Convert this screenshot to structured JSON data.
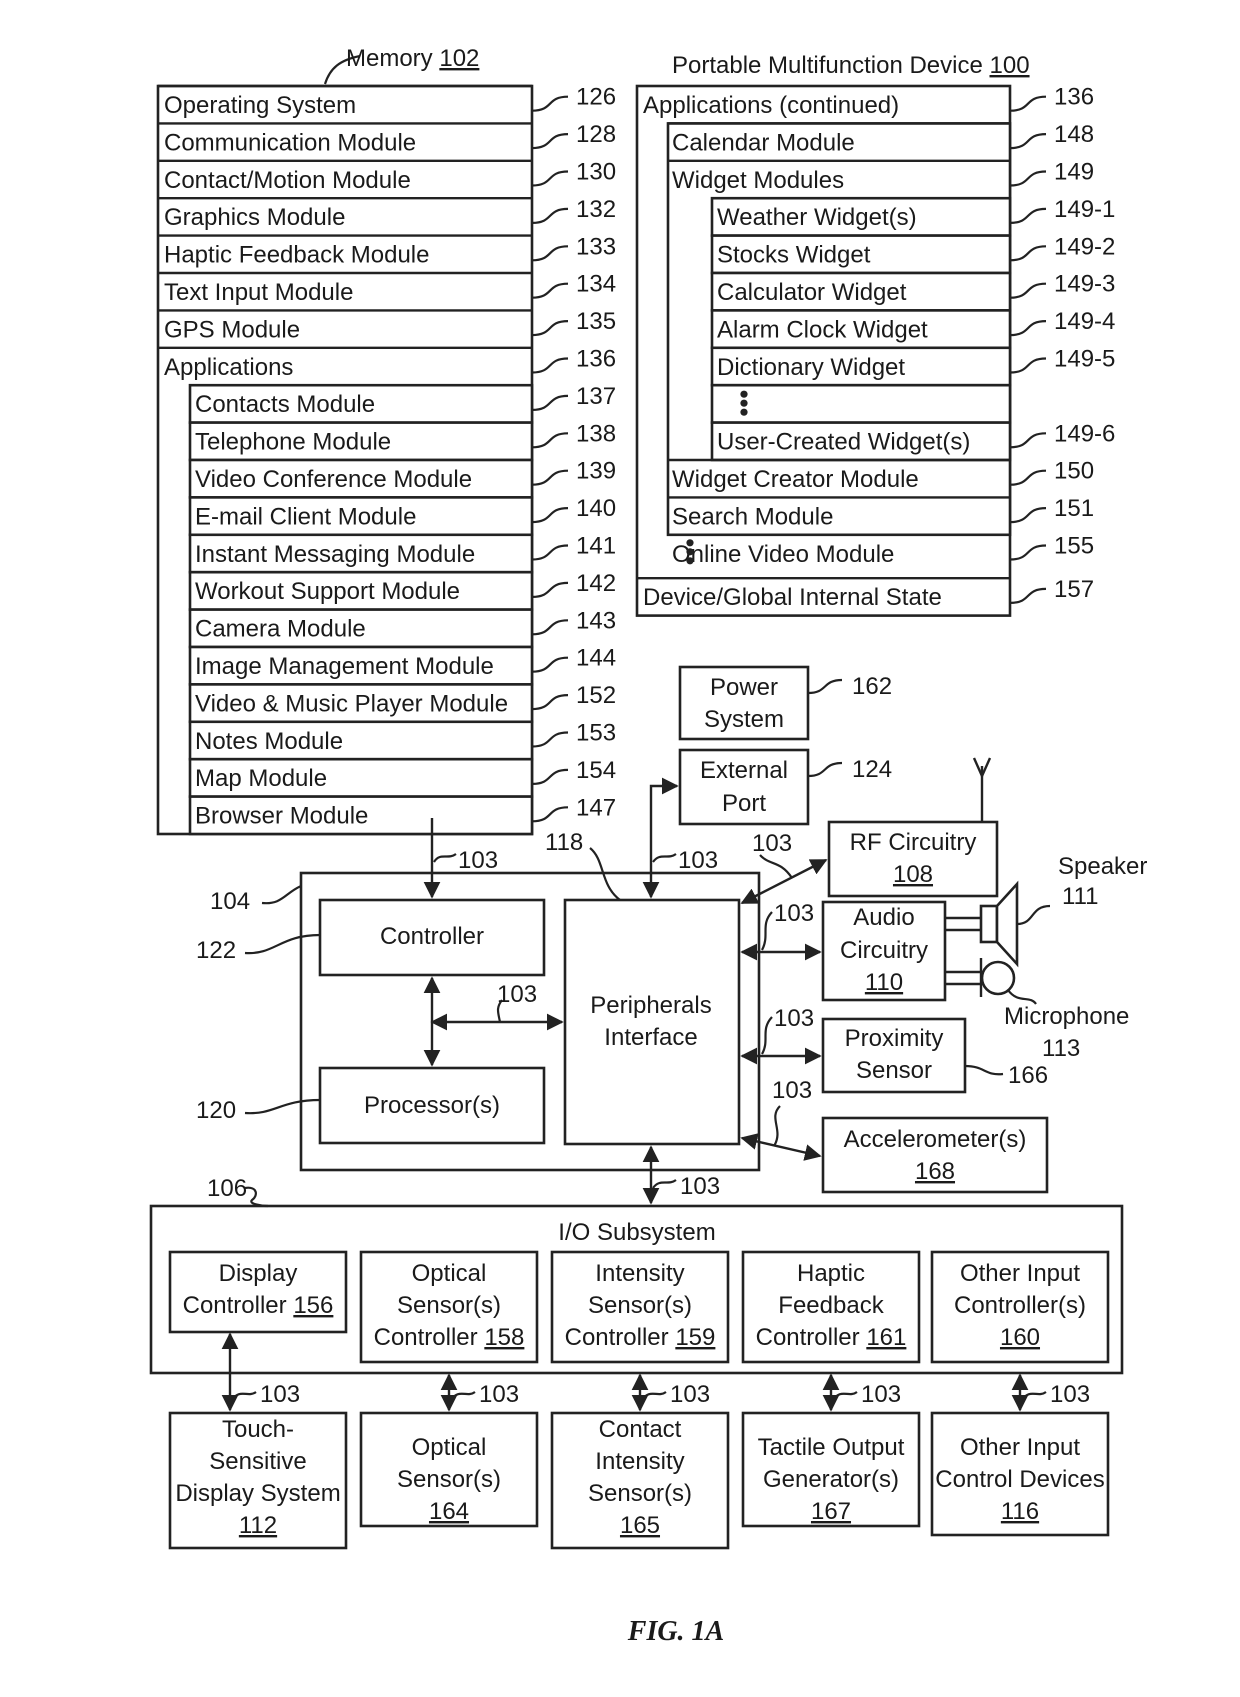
{
  "figure": {
    "caption": "FIG. 1A"
  },
  "memory": {
    "title": "Memory",
    "ref": "102",
    "rows": [
      {
        "label": "Operating System",
        "ref": "126"
      },
      {
        "label": "Communication Module",
        "ref": "128"
      },
      {
        "label": "Contact/Motion Module",
        "ref": "130"
      },
      {
        "label": "Graphics Module",
        "ref": "132"
      },
      {
        "label": "Haptic Feedback Module",
        "ref": "133"
      },
      {
        "label": "Text Input Module",
        "ref": "134"
      },
      {
        "label": "GPS Module",
        "ref": "135"
      },
      {
        "label": "Applications",
        "ref": "136"
      }
    ],
    "apps": [
      {
        "label": "Contacts Module",
        "ref": "137"
      },
      {
        "label": "Telephone Module",
        "ref": "138"
      },
      {
        "label": "Video Conference Module",
        "ref": "139"
      },
      {
        "label": "E-mail Client Module",
        "ref": "140"
      },
      {
        "label": "Instant Messaging Module",
        "ref": "141"
      },
      {
        "label": "Workout Support Module",
        "ref": "142"
      },
      {
        "label": "Camera Module",
        "ref": "143"
      },
      {
        "label": "Image Management Module",
        "ref": "144"
      },
      {
        "label": "Video & Music Player Module",
        "ref": "152"
      },
      {
        "label": "Notes Module",
        "ref": "153"
      },
      {
        "label": "Map Module",
        "ref": "154"
      },
      {
        "label": "Browser Module",
        "ref": "147"
      }
    ]
  },
  "device": {
    "title": "Portable Multifunction Device",
    "ref": "100",
    "apps_continued": {
      "label": "Applications (continued)",
      "ref": "136"
    },
    "calendar": {
      "label": "Calendar Module",
      "ref": "148"
    },
    "widget_modules": {
      "label": "Widget Modules",
      "ref": "149"
    },
    "widgets": [
      {
        "label": "Weather Widget(s)",
        "ref": "149-1"
      },
      {
        "label": "Stocks Widget",
        "ref": "149-2"
      },
      {
        "label": "Calculator Widget",
        "ref": "149-3"
      },
      {
        "label": "Alarm Clock Widget",
        "ref": "149-4"
      },
      {
        "label": "Dictionary Widget",
        "ref": "149-5"
      },
      {
        "label": "",
        "ref": ""
      },
      {
        "label": "User-Created Widget(s)",
        "ref": "149-6"
      }
    ],
    "more_modules": [
      {
        "label": "Widget Creator Module",
        "ref": "150"
      },
      {
        "label": "Search Module",
        "ref": "151"
      },
      {
        "label": "Online Video Module",
        "ref": "155"
      }
    ],
    "state": {
      "label": "Device/Global Internal State",
      "ref": "157"
    }
  },
  "power": {
    "line1": "Power",
    "line2": "System",
    "ref": "162"
  },
  "external_port": {
    "line1": "External",
    "line2": "Port",
    "ref": "124"
  },
  "rf": {
    "line1": "RF Circuitry",
    "num": "108"
  },
  "audio": {
    "line1": "Audio",
    "line2": "Circuitry",
    "num": "110"
  },
  "speaker": {
    "label": "Speaker",
    "ref": "111"
  },
  "microphone": {
    "label": "Microphone",
    "ref": "113"
  },
  "proximity": {
    "line1": "Proximity",
    "line2": "Sensor",
    "ref": "166"
  },
  "accelerometer": {
    "line1": "Accelerometer(s)",
    "num": "168"
  },
  "chip": {
    "ref": "104"
  },
  "controller": {
    "label": "Controller",
    "ref": "122"
  },
  "processor": {
    "label": "Processor(s)",
    "ref": "120"
  },
  "peripherals": {
    "line1": "Peripherals",
    "line2": "Interface",
    "ref": "118"
  },
  "bus": {
    "ref": "103"
  },
  "io": {
    "title": "I/O Subsystem",
    "ref": "106",
    "controllers": [
      {
        "lines": [
          "Display",
          "Controller"
        ],
        "num": "156"
      },
      {
        "lines": [
          "Optical",
          "Sensor(s)",
          "Controller"
        ],
        "num": "158"
      },
      {
        "lines": [
          "Intensity",
          "Sensor(s)",
          "Controller"
        ],
        "num": "159"
      },
      {
        "lines": [
          "Haptic",
          "Feedback",
          "Controller"
        ],
        "num": "161"
      },
      {
        "lines": [
          "Other Input",
          "Controller(s)"
        ],
        "num": "160"
      }
    ],
    "devices": [
      {
        "lines": [
          "Touch-",
          "Sensitive",
          "Display System"
        ],
        "num": "112"
      },
      {
        "lines": [
          "Optical",
          "Sensor(s)"
        ],
        "num": "164"
      },
      {
        "lines": [
          "Contact",
          "Intensity",
          "Sensor(s)"
        ],
        "num": "165"
      },
      {
        "lines": [
          "Tactile Output",
          "Generator(s)"
        ],
        "num": "167"
      },
      {
        "lines": [
          "Other Input",
          "Control Devices"
        ],
        "num": "116"
      }
    ]
  }
}
